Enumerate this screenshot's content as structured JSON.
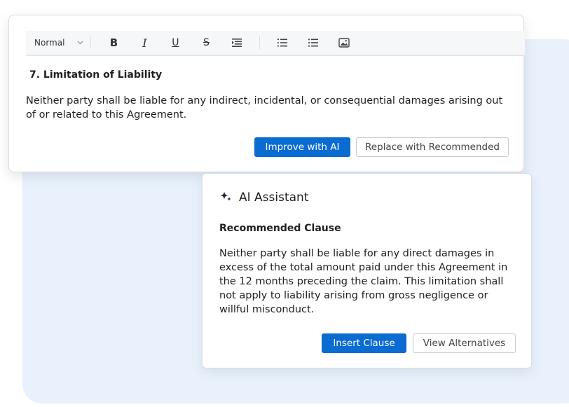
{
  "colors": {
    "accent": "#0a6bd1",
    "background_panel": "#e8f1fc",
    "text": "#1f1f1f"
  },
  "toolbar": {
    "format_value": "Normal",
    "buttons": [
      {
        "name": "bold",
        "glyph": "B"
      },
      {
        "name": "italic",
        "glyph": "I"
      },
      {
        "name": "underline",
        "glyph": "U"
      },
      {
        "name": "strikethrough",
        "glyph": "S"
      }
    ],
    "icons": [
      "chevron-down-icon",
      "indent-icon",
      "numbered-list-icon",
      "bulleted-list-icon",
      "image-icon"
    ]
  },
  "editor": {
    "title": "7. Limitation of Liability",
    "body": "Neither party shall be liable for any indirect, incidental, or consequential damages arising out of or related to this Agreement.",
    "improve_label": "Improve with AI",
    "replace_label": "Replace with Recommended"
  },
  "assistant": {
    "icon": "sparkle-icon",
    "title": "AI Assistant",
    "subtitle": "Recommended Clause",
    "body": "Neither party shall be liable for any direct damages in excess of the total amount paid under this Agreement in the 12 months preceding the claim. This limitation shall not apply to liability arising from gross negligence or willful misconduct.",
    "insert_label": "Insert Clause",
    "alternatives_label": "View Alternatives"
  }
}
